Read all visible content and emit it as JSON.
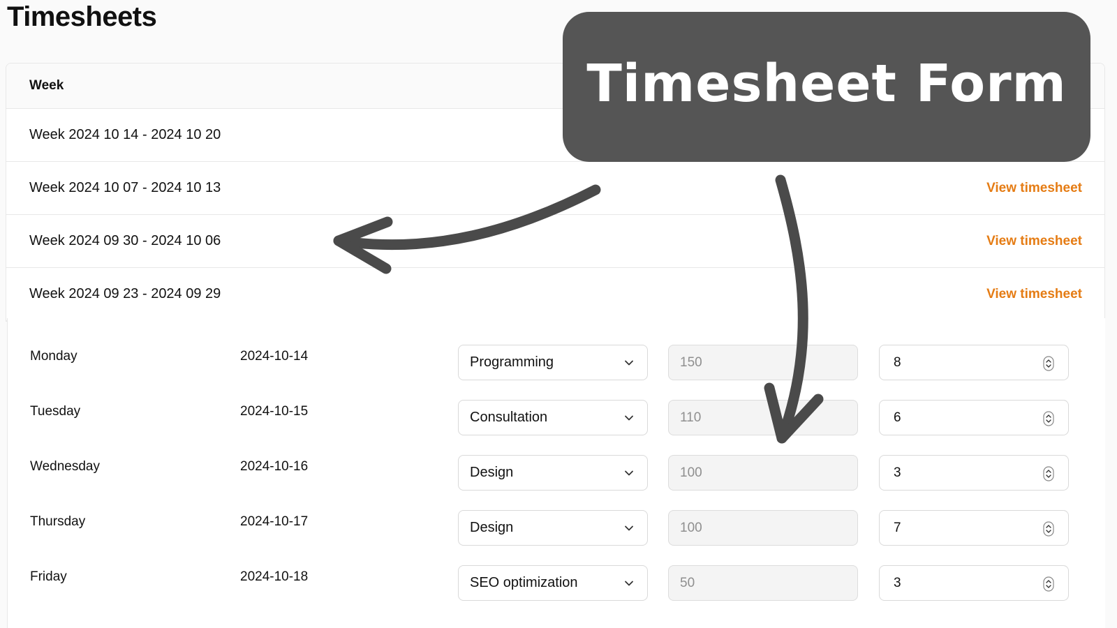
{
  "page": {
    "title": "Timesheets"
  },
  "weeks": {
    "header": "Week",
    "rows": [
      {
        "label": "Week 2024 10 14 - 2024 10 20",
        "link": ""
      },
      {
        "label": "Week 2024 10 07 - 2024 10 13",
        "link": "View timesheet"
      },
      {
        "label": "Week 2024 09 30 - 2024 10 06",
        "link": "View timesheet"
      },
      {
        "label": "Week 2024 09 23 - 2024 09 29",
        "link": "View timesheet"
      }
    ]
  },
  "form": {
    "entries": [
      {
        "day": "Monday",
        "date": "2024-10-14",
        "service": "Programming",
        "rate": "150",
        "hours": "8"
      },
      {
        "day": "Tuesday",
        "date": "2024-10-15",
        "service": "Consultation",
        "rate": "110",
        "hours": "6"
      },
      {
        "day": "Wednesday",
        "date": "2024-10-16",
        "service": "Design",
        "rate": "100",
        "hours": "3"
      },
      {
        "day": "Thursday",
        "date": "2024-10-17",
        "service": "Design",
        "rate": "100",
        "hours": "7"
      },
      {
        "day": "Friday",
        "date": "2024-10-18",
        "service": "SEO optimization",
        "rate": "50",
        "hours": "3"
      }
    ]
  },
  "callout": {
    "text": "Timesheet Form"
  },
  "colors": {
    "link": "#e57c14",
    "callout_bg": "#555555",
    "arrow": "#4a4a4a"
  },
  "icons": [
    "chevron-down-icon",
    "number-spinner-icon",
    "curved-arrow-icon"
  ]
}
